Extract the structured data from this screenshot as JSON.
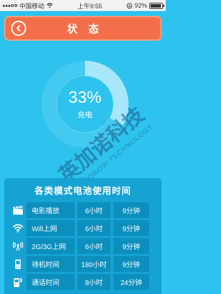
{
  "status_bar": {
    "carrier": "中国移动",
    "time": "上午9:55",
    "battery_percent": "92%",
    "battery_level": 0.92
  },
  "header": {
    "title": "状态",
    "back_icon": "chevron-left-circle-icon"
  },
  "battery": {
    "percent_text": "33%",
    "fraction": 0.33,
    "state": "充电"
  },
  "watermark": {
    "brand_cn": "英加诺科技",
    "brand_en": "INJONOW TECHNOLOGY"
  },
  "usage_table": {
    "title": "各类模式电池使用时间",
    "rows": [
      {
        "icon": "clapperboard-icon",
        "name": "电影播放",
        "hours": "6小时",
        "minutes": "9分钟"
      },
      {
        "icon": "wifi-icon",
        "name": "Wifi上网",
        "hours": "6小时",
        "minutes": "9分钟"
      },
      {
        "icon": "antenna-icon",
        "name": "2G/3G上网",
        "hours": "6小时",
        "minutes": "9分钟"
      },
      {
        "icon": "phone-standby-icon",
        "name": "待机时间",
        "hours": "180小时",
        "minutes": "9分钟"
      },
      {
        "icon": "phone-call-icon",
        "name": "通话时间",
        "hours": "8小时",
        "minutes": "24分钟"
      }
    ]
  },
  "colors": {
    "background": "#2dc3ee",
    "header": "#f26f4a",
    "panel": "#16a3d3",
    "ring": "#a8e6fa"
  }
}
